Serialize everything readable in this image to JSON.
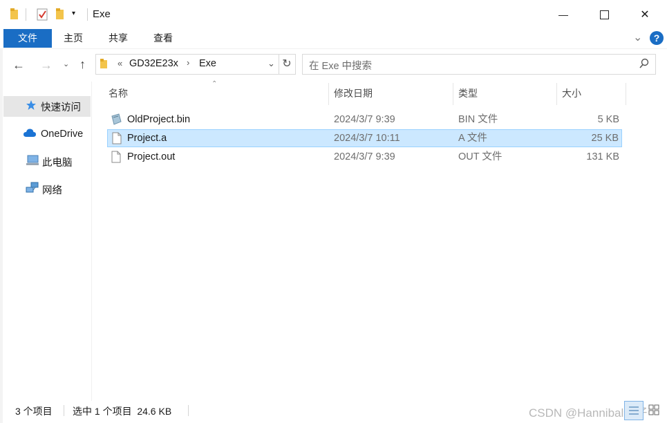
{
  "window": {
    "title": "Exe",
    "minimize_glyph": "—",
    "maximize_glyph": "☐",
    "close_glyph": "✕"
  },
  "ribbon": {
    "tabs": [
      "文件",
      "主页",
      "共享",
      "查看"
    ],
    "help_glyph": "?",
    "expand_glyph": "⌄"
  },
  "nav": {
    "path_prefix": "«",
    "path": [
      "GD32E23x",
      "Exe"
    ],
    "search_placeholder": "在 Exe 中搜索"
  },
  "sidebar": {
    "items": [
      {
        "label": "快速访问",
        "icon": "star-icon",
        "selected": true
      },
      {
        "label": "OneDrive",
        "icon": "cloud-icon",
        "selected": false
      },
      {
        "label": "此电脑",
        "icon": "computer-icon",
        "selected": false
      },
      {
        "label": "网络",
        "icon": "network-icon",
        "selected": false
      }
    ]
  },
  "list": {
    "columns": [
      "名称",
      "修改日期",
      "类型",
      "大小"
    ],
    "rows": [
      {
        "name": "OldProject.bin",
        "date": "2024/3/7 9:39",
        "type": "BIN 文件",
        "size": "5 KB",
        "icon": "bin-file-icon",
        "selected": false
      },
      {
        "name": "Project.a",
        "date": "2024/3/7 10:11",
        "type": "A 文件",
        "size": "25 KB",
        "icon": "file-icon",
        "selected": true
      },
      {
        "name": "Project.out",
        "date": "2024/3/7 9:39",
        "type": "OUT 文件",
        "size": "131 KB",
        "icon": "file-icon",
        "selected": false
      }
    ]
  },
  "status": {
    "count": "3 个项目",
    "selection": "选中 1 个项目  24.6 KB",
    "watermark": "CSDN @Hannibal仔仔"
  },
  "colors": {
    "accent": "#1a6dc4",
    "selection": "#cce8ff",
    "selection_border": "#99d1ff"
  }
}
